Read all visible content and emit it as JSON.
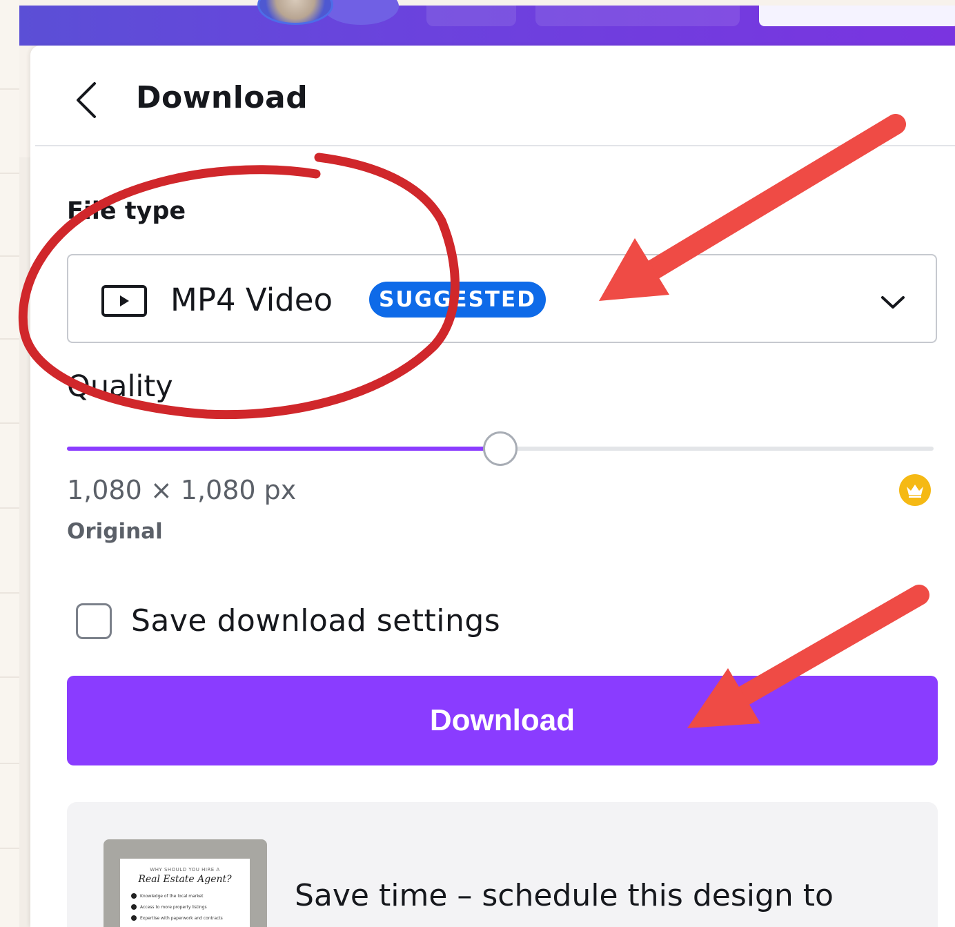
{
  "panel": {
    "title": "Download",
    "back_icon": "chevron-left-icon"
  },
  "file_type": {
    "label": "File type",
    "selected": "MP4 Video",
    "badge": "SUGGESTED",
    "icon": "video-play-icon",
    "dropdown_icon": "chevron-down-icon"
  },
  "quality": {
    "label": "Quality",
    "level": 0.5,
    "dimensions": "1,080 × 1,080 px",
    "size_name": "Original",
    "premium_icon": "crown-icon"
  },
  "save_settings": {
    "label": "Save download settings",
    "checked": false
  },
  "download_button": {
    "label": "Download"
  },
  "promo": {
    "text": "Save time – schedule this design to",
    "thumbnail": {
      "kicker": "WHY SHOULD YOU HIRE A",
      "title": "Real Estate Agent?",
      "items": [
        "Knowledge of the local market",
        "Access to more property listings",
        "Expertise with paperwork and contracts"
      ]
    }
  },
  "colors": {
    "accent": "#8b3dff",
    "badge": "#0e6ae8",
    "premium": "#f5b914",
    "annotation_circle": "#d0272b",
    "annotation_arrow": "#ef4b45"
  }
}
